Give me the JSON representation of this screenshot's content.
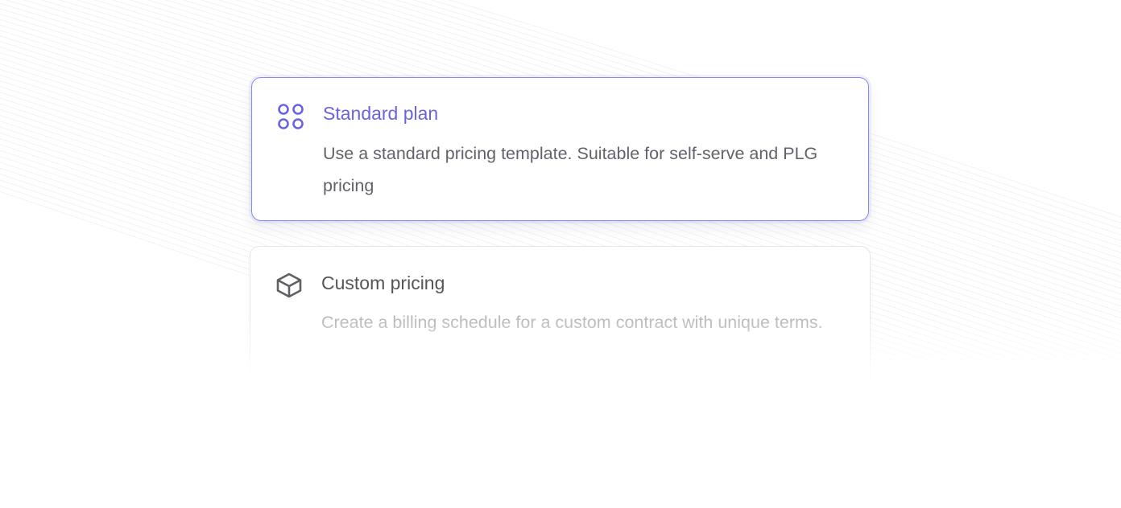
{
  "options": [
    {
      "title": "Standard plan",
      "description": "Use a standard pricing template. Suitable for self-serve and PLG pricing",
      "icon": "grid-icon",
      "selected": true
    },
    {
      "title": "Custom pricing",
      "description": "Create a billing schedule for a custom contract with unique terms.",
      "icon": "box-icon",
      "selected": false
    }
  ],
  "colors": {
    "accent": "#6a63e0",
    "selected_border": "#8b88ee",
    "title_muted": "#55555a",
    "text": "#62626a",
    "text_faded": "#b3b3b8"
  }
}
